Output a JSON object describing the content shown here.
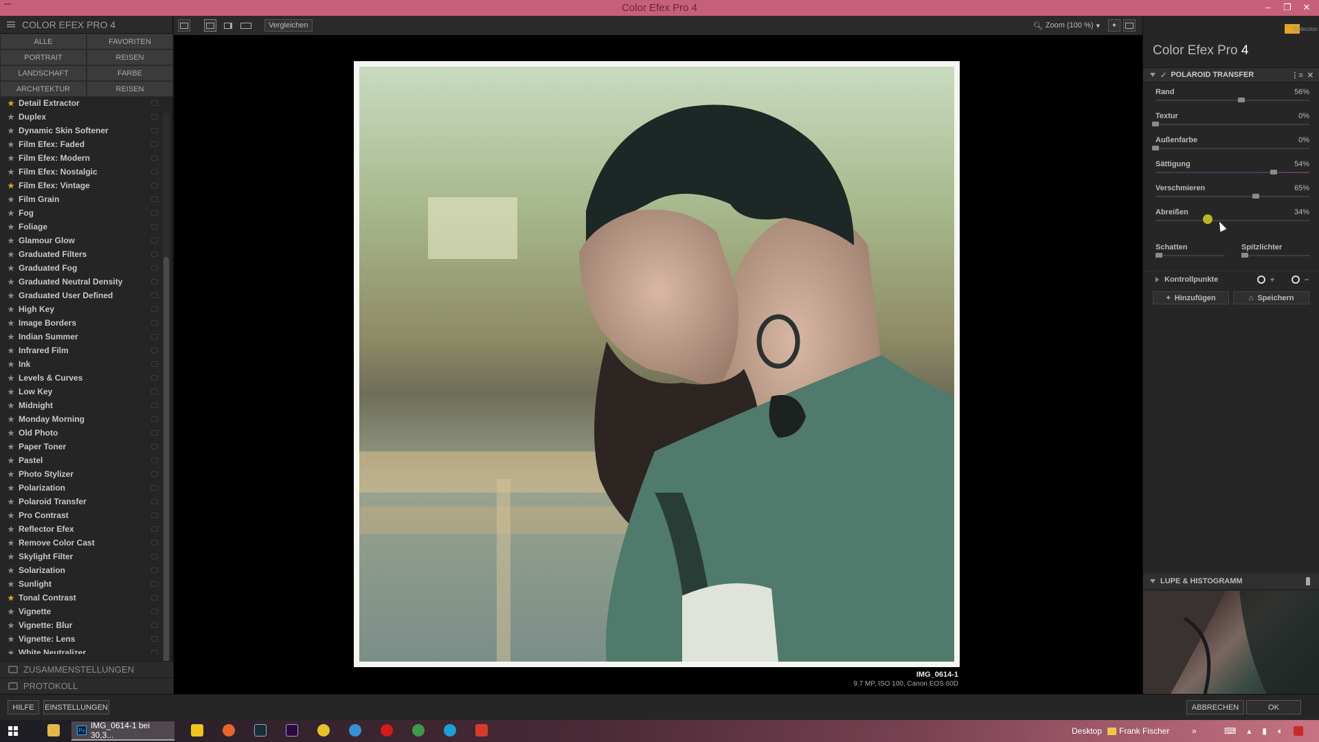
{
  "window": {
    "title": "Color Efex Pro 4"
  },
  "left": {
    "header": "COLOR EFEX PRO 4",
    "categories": [
      {
        "label": "ALLE"
      },
      {
        "label": "FAVORITEN"
      },
      {
        "label": "PORTRAIT"
      },
      {
        "label": "REISEN"
      },
      {
        "label": "LANDSCHAFT"
      },
      {
        "label": "FARBE"
      },
      {
        "label": "ARCHITEKTUR"
      },
      {
        "label": "REISEN"
      }
    ],
    "filters": [
      {
        "label": "Detail Extractor",
        "fav": true
      },
      {
        "label": "Duplex",
        "fav": false
      },
      {
        "label": "Dynamic Skin Softener",
        "fav": false
      },
      {
        "label": "Film Efex: Faded",
        "fav": false
      },
      {
        "label": "Film Efex: Modern",
        "fav": false
      },
      {
        "label": "Film Efex: Nostalgic",
        "fav": false
      },
      {
        "label": "Film Efex: Vintage",
        "fav": true
      },
      {
        "label": "Film Grain",
        "fav": false
      },
      {
        "label": "Fog",
        "fav": false
      },
      {
        "label": "Foliage",
        "fav": false
      },
      {
        "label": "Glamour Glow",
        "fav": false
      },
      {
        "label": "Graduated Filters",
        "fav": false
      },
      {
        "label": "Graduated Fog",
        "fav": false
      },
      {
        "label": "Graduated Neutral Density",
        "fav": false
      },
      {
        "label": "Graduated User Defined",
        "fav": false
      },
      {
        "label": "High Key",
        "fav": false
      },
      {
        "label": "Image Borders",
        "fav": false
      },
      {
        "label": "Indian Summer",
        "fav": false
      },
      {
        "label": "Infrared Film",
        "fav": false
      },
      {
        "label": "Ink",
        "fav": false
      },
      {
        "label": "Levels & Curves",
        "fav": false
      },
      {
        "label": "Low Key",
        "fav": false
      },
      {
        "label": "Midnight",
        "fav": false
      },
      {
        "label": "Monday Morning",
        "fav": false
      },
      {
        "label": "Old Photo",
        "fav": false
      },
      {
        "label": "Paper Toner",
        "fav": false
      },
      {
        "label": "Pastel",
        "fav": false
      },
      {
        "label": "Photo Stylizer",
        "fav": false
      },
      {
        "label": "Polarization",
        "fav": false
      },
      {
        "label": "Polaroid Transfer",
        "fav": false
      },
      {
        "label": "Pro Contrast",
        "fav": false
      },
      {
        "label": "Reflector Efex",
        "fav": false
      },
      {
        "label": "Remove Color Cast",
        "fav": false
      },
      {
        "label": "Skylight Filter",
        "fav": false
      },
      {
        "label": "Solarization",
        "fav": false
      },
      {
        "label": "Sunlight",
        "fav": false
      },
      {
        "label": "Tonal Contrast",
        "fav": true
      },
      {
        "label": "Vignette",
        "fav": false
      },
      {
        "label": "Vignette: Blur",
        "fav": false
      },
      {
        "label": "Vignette: Lens",
        "fav": false
      },
      {
        "label": "White Neutralizer",
        "fav": false
      }
    ],
    "sections": {
      "presets": "ZUSAMMENSTELLUNGEN",
      "history": "PROTOKOLL"
    }
  },
  "toolbar": {
    "compare": "Vergleichen",
    "zoom": "Zoom (100 %)"
  },
  "image": {
    "name": "IMG_0614-1",
    "meta": "9.7 MP, ISO 100, Canon EOS 60D"
  },
  "right": {
    "brand": {
      "title": "Color Efex Pro",
      "version": "4",
      "logo_sub": "Collection"
    },
    "filter_name": "POLAROID TRANSFER",
    "params": [
      {
        "label": "Rand",
        "value": "56%",
        "level": 56
      },
      {
        "label": "Textur",
        "value": "0%",
        "level": 0
      },
      {
        "label": "Außenfarbe",
        "value": "0%",
        "level": 0
      },
      {
        "label": "Sättigung",
        "value": "54%",
        "level": 77
      },
      {
        "label": "Verschmieren",
        "value": "65%",
        "level": 65
      },
      {
        "label": "Abreißen",
        "value": "34%",
        "level": 34
      }
    ],
    "shadows": "Schatten",
    "highlights": "Spitzlichter",
    "control_points": "Kontrollpunkte",
    "add": "Hinzufügen",
    "save": "Speichern",
    "loupe": "LUPE & HISTOGRAMM"
  },
  "bottom": {
    "help": "HILFE",
    "settings": "EINSTELLUNGEN",
    "cancel": "ABBRECHEN",
    "ok": "OK"
  },
  "taskbar": {
    "task": "IMG_0614-1 bei 30,3...",
    "desktop": "Desktop",
    "user": "Frank Fischer"
  }
}
